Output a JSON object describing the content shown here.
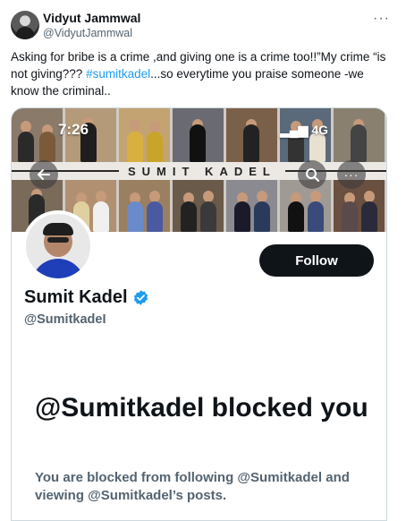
{
  "tweet": {
    "author_name": "Vidyut Jammwal",
    "author_handle": "@VidyutJammwal",
    "more_icon": "more-horizontal-icon",
    "text_before": "Asking for bribe is a crime ,and giving one is a crime too!!”My crime “is not giving??? ",
    "hashtag": "#sumitkadel",
    "text_after": "...so everytime you praise someone -we know the criminal..",
    "hashtag_color": "#1d9bf0"
  },
  "screenshot": {
    "status_time": "7:26",
    "status_signal": "4G",
    "banner_text": "SUMIT KADEL",
    "back_icon": "arrow-left-icon",
    "search_icon": "search-icon",
    "menu_icon": "more-horizontal-icon",
    "profile_name": "Sumit Kadel",
    "profile_handle": "@SumitkadeI",
    "follow_label": "Follow",
    "blocked_title": "@Sumitkadel blocked you",
    "blocked_desc": "You are blocked from following @Sumitkadel and viewing @Sumitkadel’s posts.",
    "verified_color": "#1d9bf0"
  }
}
